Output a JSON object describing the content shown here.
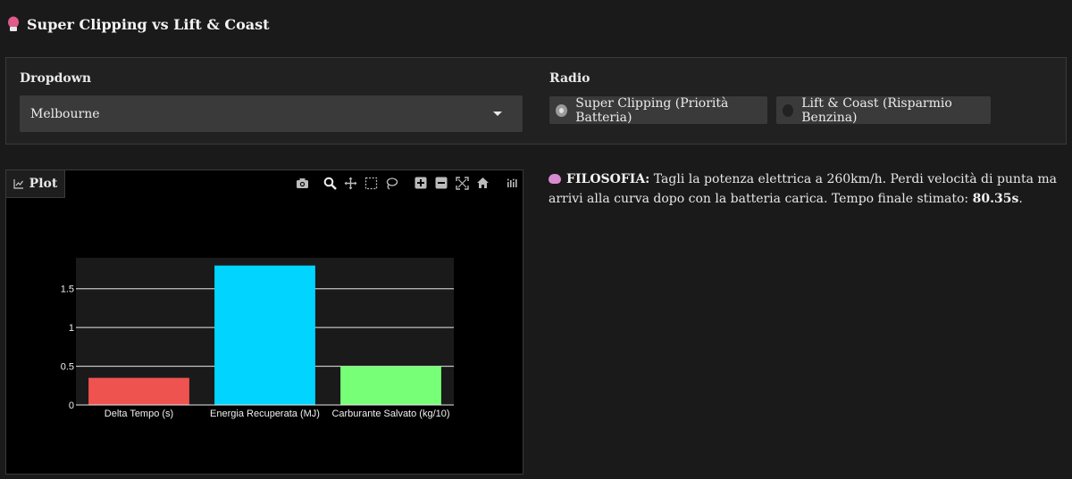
{
  "header": {
    "title": "Super Clipping vs Lift & Coast"
  },
  "controls": {
    "dropdown_label": "Dropdown",
    "dropdown_value": "Melbourne",
    "radio_label": "Radio",
    "radio_options": [
      "Super Clipping (Priorità Batteria)",
      "Lift & Coast (Risparmio Benzina)"
    ],
    "radio_selected": 0
  },
  "plot": {
    "tab_label": "Plot",
    "modebar_icons": [
      "camera-icon",
      "zoom-icon",
      "pan-icon",
      "box-select-icon",
      "lasso-icon",
      "zoom-in-icon",
      "zoom-out-icon",
      "autoscale-icon",
      "home-icon",
      "plotly-logo-icon"
    ]
  },
  "chart_data": {
    "type": "bar",
    "categories": [
      "Delta Tempo (s)",
      "Energia Recuperata (MJ)",
      "Carburante Salvato (kg/10)"
    ],
    "values": [
      0.35,
      1.8,
      0.5
    ],
    "colors": [
      "#ef5350",
      "#00d4ff",
      "#77ff77"
    ],
    "ylim": [
      0,
      1.9
    ],
    "yticks": [
      0,
      0.5,
      1,
      1.5
    ],
    "ytick_labels": [
      "0",
      "0.5",
      "1",
      "1.5"
    ],
    "grid": true,
    "plot_bg": "#1a1a1a",
    "paper_bg": "#000000"
  },
  "filosofia": {
    "label": "FILOSOFIA:",
    "text": " Tagli la potenza elettrica a 260km/h. Perdi velocità di punta ma arrivi alla curva dopo con la batteria carica. Tempo finale stimato: ",
    "time": "80.35s",
    "end": "."
  }
}
